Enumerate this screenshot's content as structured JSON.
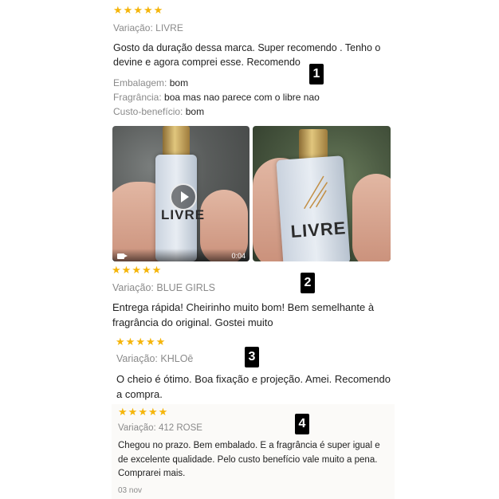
{
  "colors": {
    "star": "#f5b50a",
    "muted": "#8a8a8a",
    "text": "#222222",
    "badge_bg": "#000000"
  },
  "icons": [
    "star-icon",
    "play-icon",
    "video-camera-icon"
  ],
  "reviews": [
    {
      "stars": 5,
      "variation_label": "Variação:",
      "variation_value": "LIVRE",
      "text": "Gosto da duração dessa marca. Super recomendo . Tenho o devine e agora comprei esse. Recomendo",
      "attributes": [
        {
          "label": "Embalagem:",
          "value": "bom"
        },
        {
          "label": "Fragrância:",
          "value": "boa mas nao parece com o libre nao"
        },
        {
          "label": "Custo-benefício:",
          "value": "bom"
        }
      ],
      "media": {
        "video_duration": "0:04",
        "video_label": "LIVRE",
        "photo_label": "LIVRE"
      },
      "badge": "1"
    },
    {
      "stars": 5,
      "variation_label": "Variação:",
      "variation_value": "BLUE GIRLS",
      "text": "Entrega rápida! Cheirinho muito bom! Bem semelhante à fragrância do original. Gostei muito",
      "badge": "2"
    },
    {
      "stars": 5,
      "variation_label": "Variação:",
      "variation_value": "KHLOē",
      "text": "O cheio é ótimo. Boa fixação e projeção. Amei. Recomendo a compra.",
      "badge": "3"
    },
    {
      "stars": 5,
      "variation_label": "Variação:",
      "variation_value": "412 ROSE",
      "text": "Chegou no prazo. Bem embalado. E a fragrância é super igual e de excelente qualidade. Pelo custo benefício vale muito a pena. Comprarei mais.",
      "date": "03 nov",
      "badge": "4"
    }
  ]
}
